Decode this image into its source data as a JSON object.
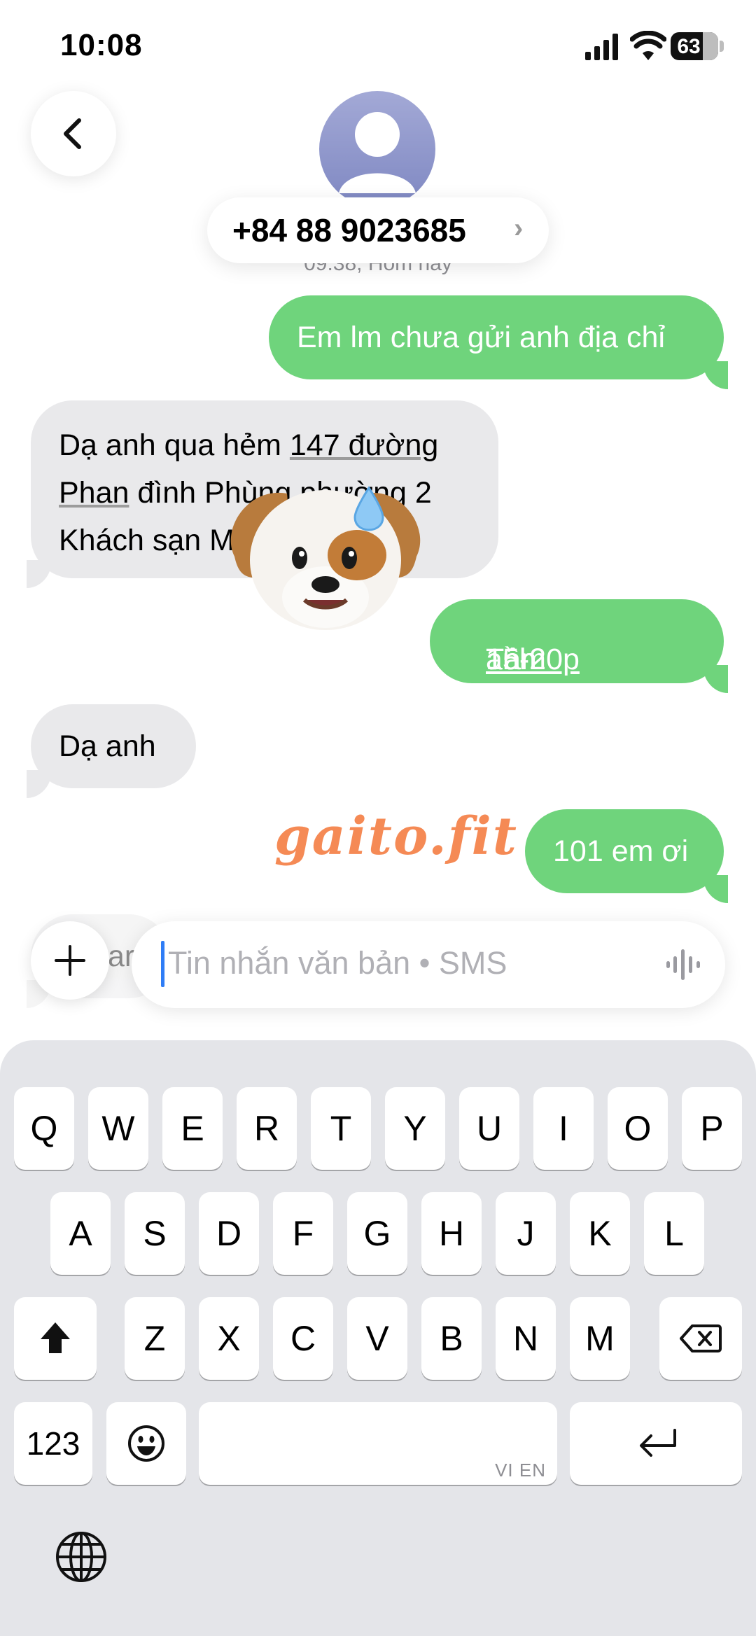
{
  "status_bar": {
    "time": "10:08",
    "battery": "63"
  },
  "header": {
    "contact": "+84 88 9023685",
    "chevron": "›",
    "timestamp": "09:38, Hôm nay"
  },
  "messages": [
    {
      "direction": "out",
      "parts": [
        "Em lm chưa gửi anh địa chỉ"
      ]
    },
    {
      "direction": "in",
      "lines": [
        [
          "Dạ anh qua hẻm ",
          "147 đường"
        ],
        [
          "Phan",
          " đình Phùng phường 2"
        ],
        [
          "Khách sạn Miên",
          ""
        ]
      ]
    },
    {
      "direction": "out",
      "parts": [
        "Tầm ",
        "15-20p",
        " anh"
      ]
    },
    {
      "direction": "in",
      "parts": [
        "Dạ anh"
      ]
    },
    {
      "direction": "out",
      "parts": [
        "101 em ơi"
      ]
    },
    {
      "direction": "in",
      "parts": [
        "ar"
      ]
    }
  ],
  "watermark": "gaito.fit",
  "input": {
    "placeholder": "Tin nhắn văn bản • SMS"
  },
  "keyboard": {
    "row1": [
      "Q",
      "W",
      "E",
      "R",
      "T",
      "Y",
      "U",
      "I",
      "O",
      "P"
    ],
    "row2": [
      "A",
      "S",
      "D",
      "F",
      "G",
      "H",
      "J",
      "K",
      "L"
    ],
    "row3": [
      "Z",
      "X",
      "C",
      "V",
      "B",
      "N",
      "M"
    ],
    "numbers_label": "123",
    "space_lang": "VI EN"
  },
  "colors": {
    "outgoing": "#6fd47c",
    "incoming": "#e9e9eb",
    "cursor": "#2f7df6",
    "watermark": "#f58a55"
  },
  "icons": [
    "back-chevron-icon",
    "contact-avatar-icon",
    "plus-icon",
    "voice-waveform-icon",
    "shift-icon",
    "delete-icon",
    "emoji-icon",
    "return-icon",
    "globe-icon",
    "signal-icon",
    "wifi-icon",
    "battery-icon"
  ]
}
